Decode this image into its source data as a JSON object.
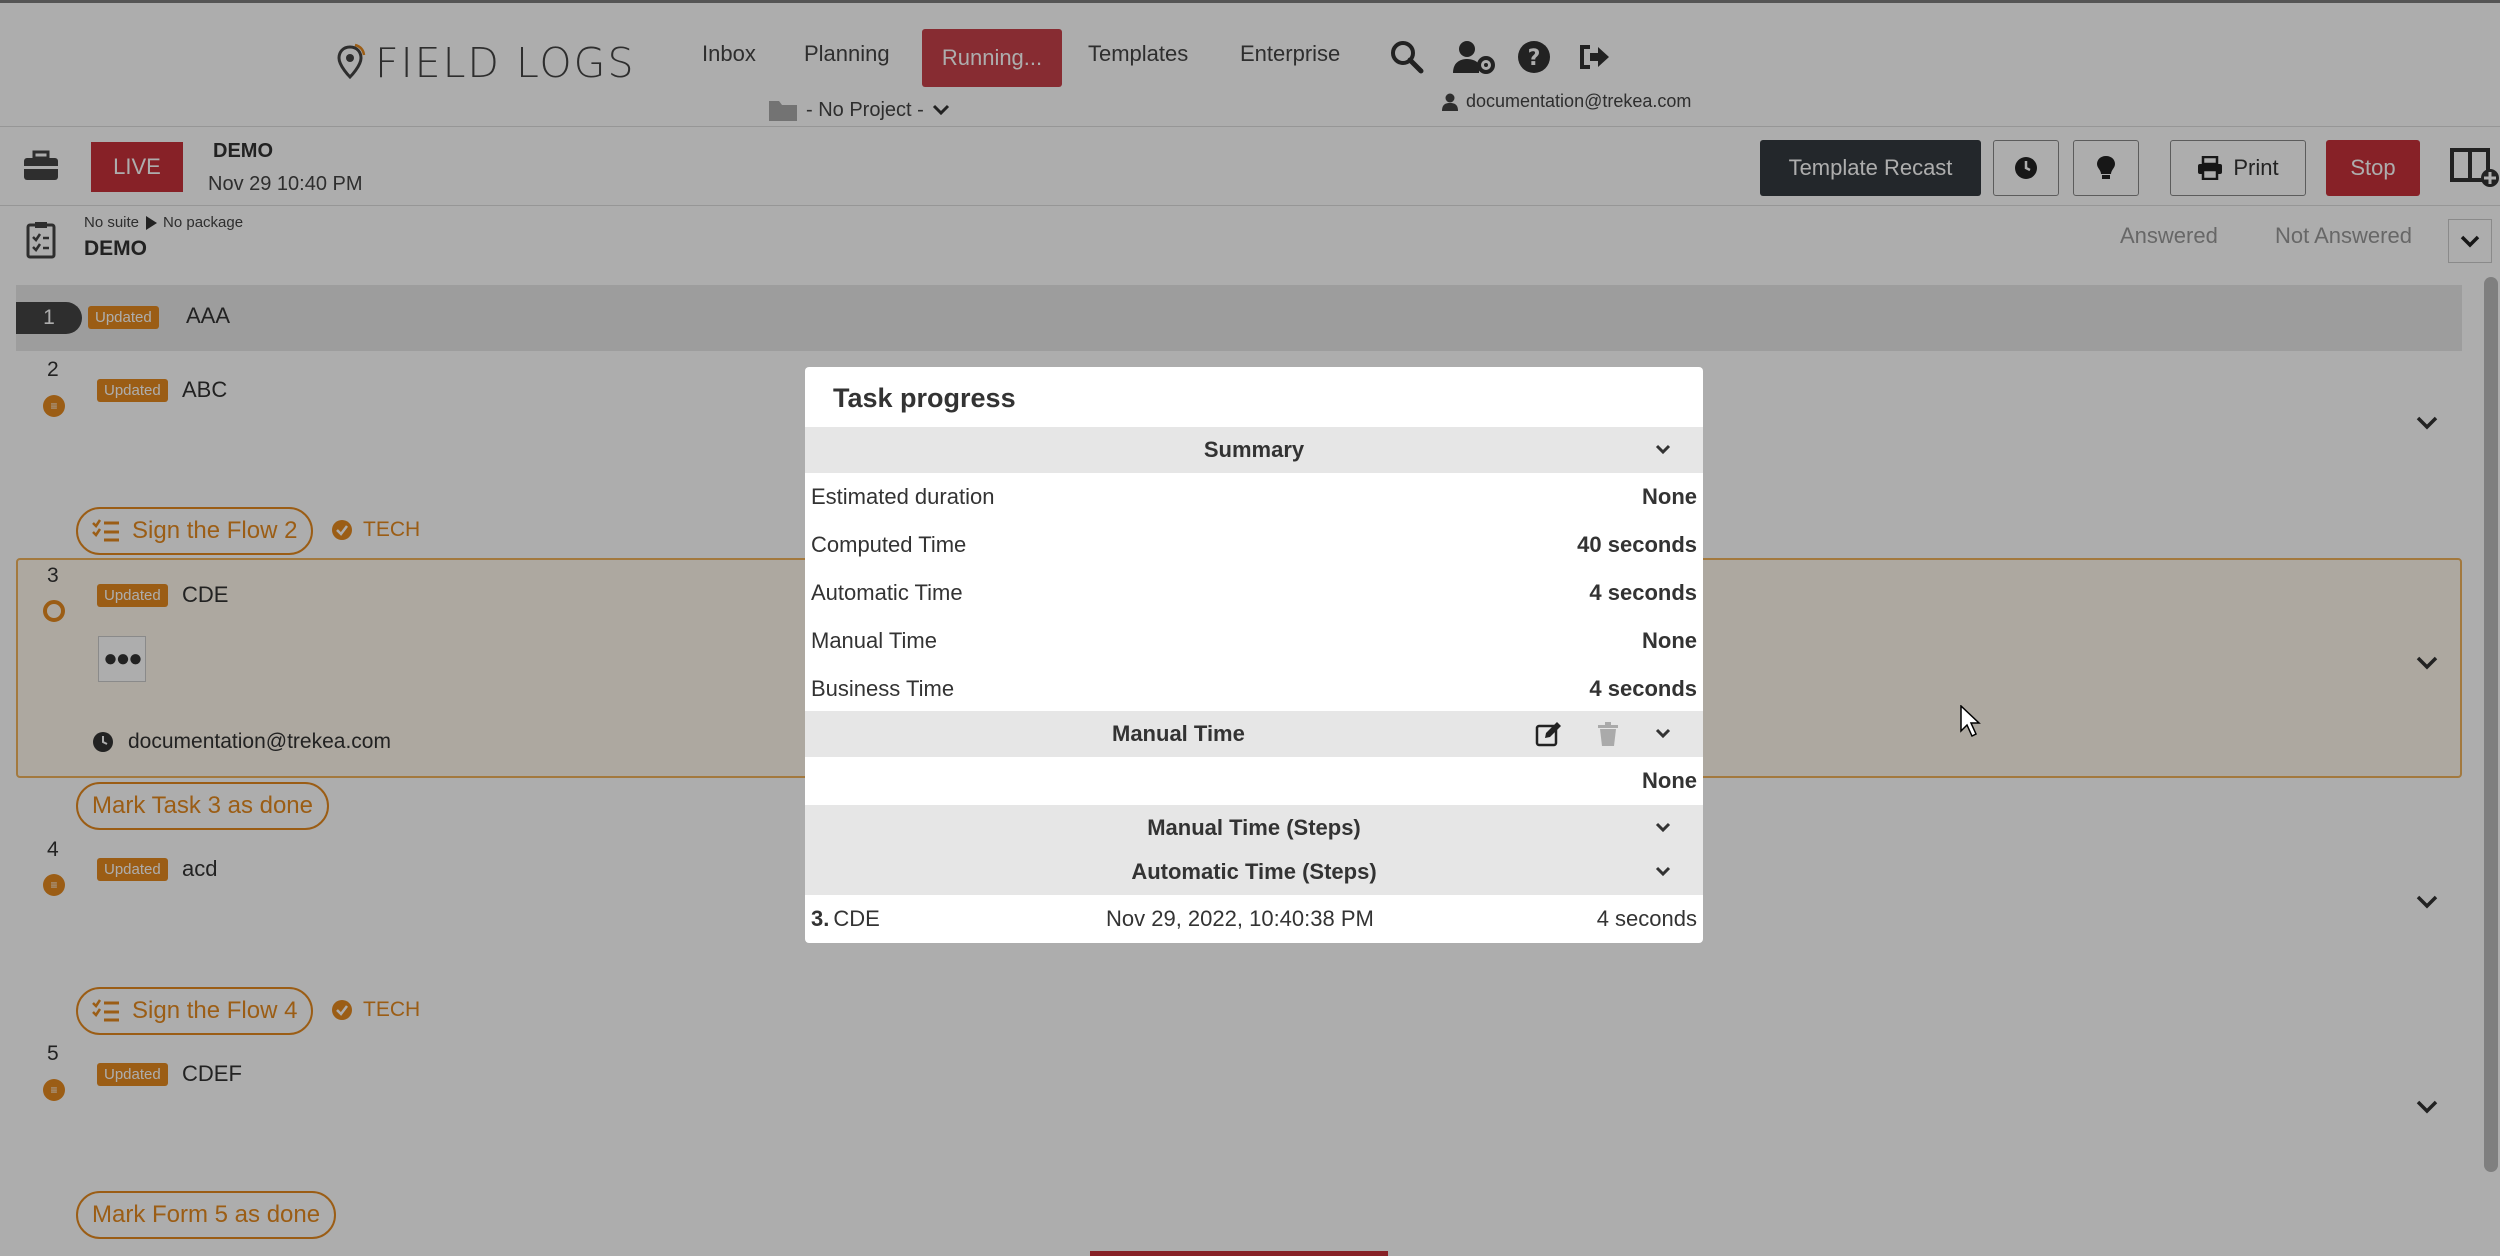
{
  "nav": {
    "logo_text": "FIELD LOGS",
    "items": [
      "Inbox",
      "Planning",
      "Running...",
      "Templates",
      "Enterprise"
    ],
    "project": "- No Project -",
    "user_email": "documentation@trekea.com"
  },
  "header": {
    "live_label": "LIVE",
    "title": "DEMO",
    "date": "Nov 29 10:40 PM",
    "template_recast": "Template Recast",
    "print": "Print",
    "stop": "Stop"
  },
  "suite": {
    "suite_label": "No suite",
    "package_label": "No package",
    "name": "DEMO",
    "answered": "Answered",
    "not_answered": "Not Answered"
  },
  "list": {
    "badge": "Updated",
    "rows": [
      {
        "num": "1",
        "title": "AAA"
      },
      {
        "num": "2",
        "title": "ABC"
      },
      {
        "num": "3",
        "title": "CDE"
      },
      {
        "num": "4",
        "title": "acd"
      },
      {
        "num": "5",
        "title": "CDEF"
      }
    ],
    "sign_flow_2": "Sign the Flow 2",
    "sign_flow_4": "Sign the Flow 4",
    "tech": "TECH",
    "row3_user": "documentation@trekea.com",
    "mark_task_3": "Mark Task 3 as done",
    "mark_form_5": "Mark Form 5 as done",
    "dots": "●●●"
  },
  "modal": {
    "title": "Task progress",
    "summary_header": "Summary",
    "summary": [
      {
        "label": "Estimated duration",
        "value": "None"
      },
      {
        "label": "Computed Time",
        "value": "40 seconds"
      },
      {
        "label": "Automatic Time",
        "value": "4 seconds"
      },
      {
        "label": "Manual Time",
        "value": "None"
      },
      {
        "label": "Business Time",
        "value": "4 seconds"
      }
    ],
    "manual_time_header": "Manual Time",
    "manual_time_value": "None",
    "manual_steps_header": "Manual Time (Steps)",
    "automatic_steps_header": "Automatic Time (Steps)",
    "step": {
      "num": "3.",
      "name": "CDE",
      "date": "Nov 29, 2022, 10:40:38 PM",
      "duration": "4 seconds"
    }
  },
  "colors": {
    "accent": "#e58a1f",
    "danger": "#c8323a",
    "running": "#c8424a",
    "dark": "#343a40"
  }
}
